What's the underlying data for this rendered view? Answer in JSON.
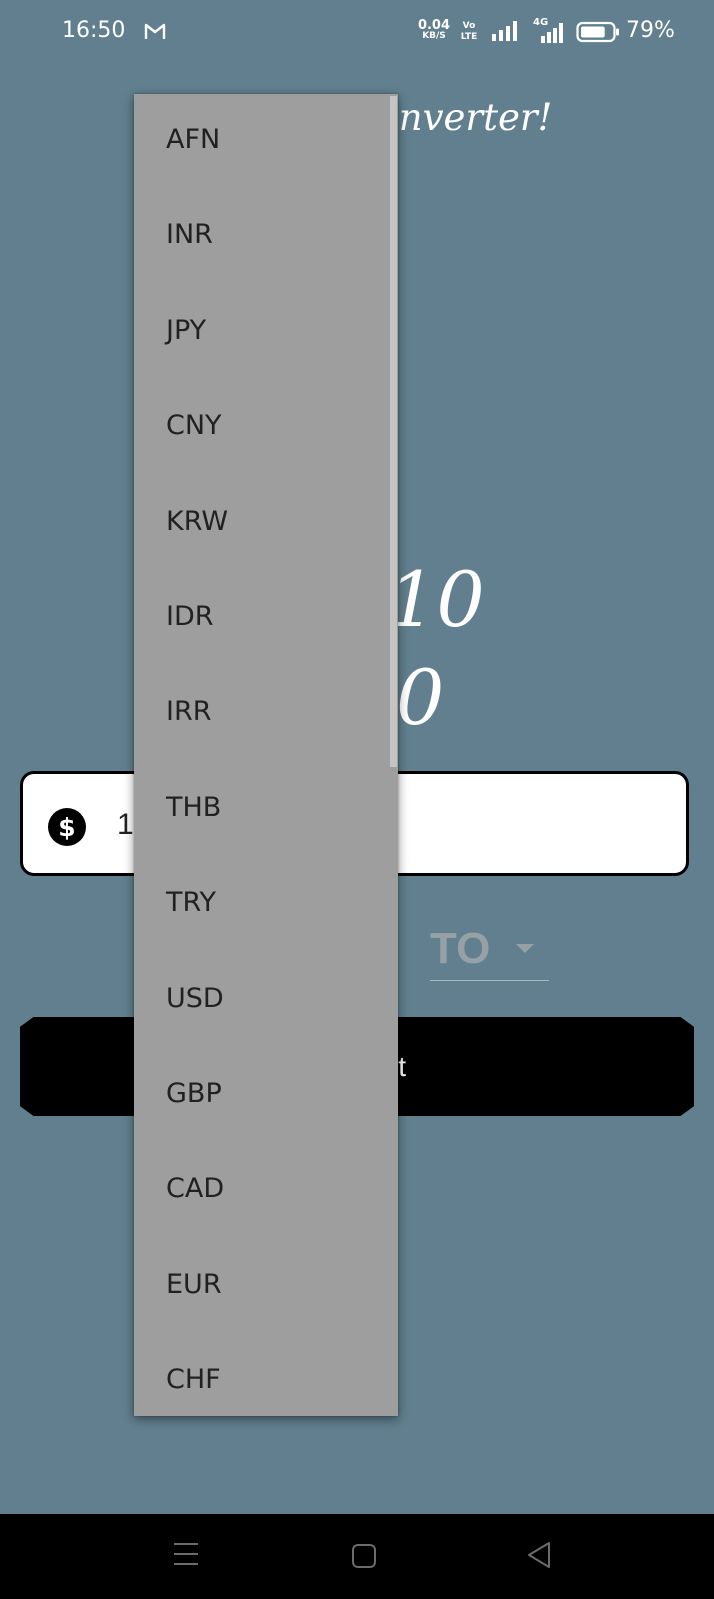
{
  "status_bar": {
    "time": "16:50",
    "notification_icon": "gmail-icon",
    "net_speed_value": "0.04",
    "net_speed_unit": "KB/S",
    "volte_top": "Vo",
    "volte_bottom": "LTE",
    "network_type": "4G",
    "battery_percent": "79%",
    "battery_level": 0.79
  },
  "app": {
    "title": "Currency Converter!",
    "result_line_1": "10",
    "result_line_2": "0",
    "amount_value": "1",
    "amount_icon": "dollar-icon",
    "to_label": "TO",
    "convert_label": "Convert"
  },
  "dropdown": {
    "items": [
      "AFN",
      "INR",
      "JPY",
      "CNY",
      "KRW",
      "IDR",
      "IRR",
      "THB",
      "TRY",
      "USD",
      "GBP",
      "CAD",
      "EUR",
      "CHF"
    ]
  },
  "nav_bar": {
    "icons": [
      "menu-icon",
      "home-icon",
      "back-icon"
    ]
  },
  "colors": {
    "background": "#617f8e",
    "dropdown_background": "#9e9e9e",
    "dropdown_text": "#212121",
    "button_background": "#000000",
    "field_background": "#ffffff",
    "to_label": "#97a0a4"
  }
}
